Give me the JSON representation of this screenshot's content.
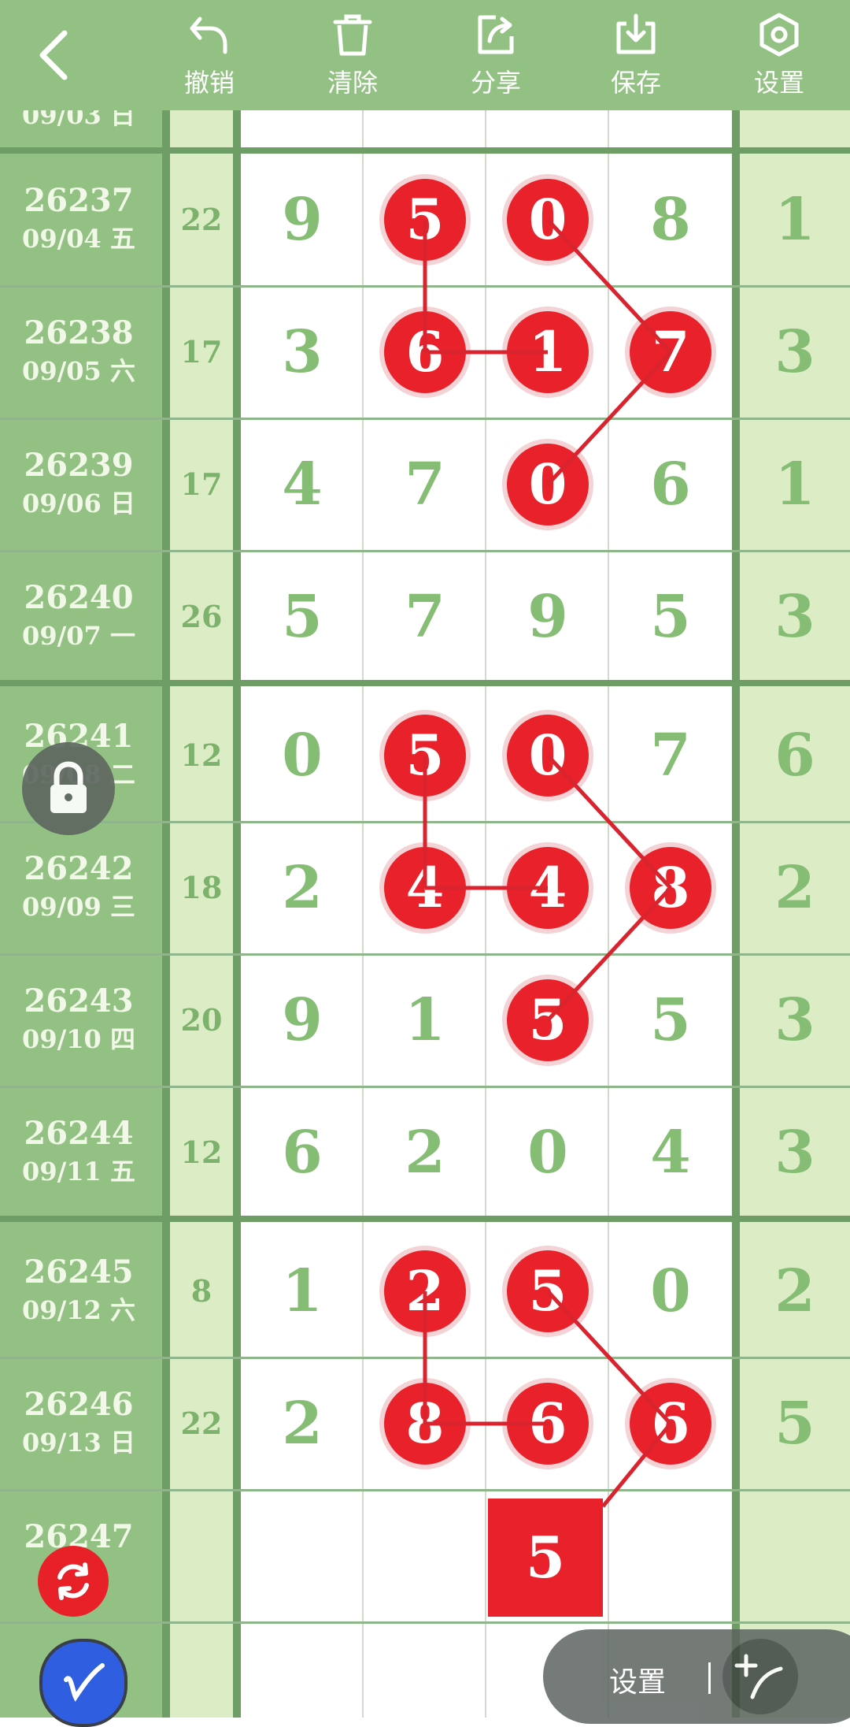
{
  "toolbar": {
    "back_icon": "chevron-left-icon",
    "buttons": [
      {
        "label": "撤销",
        "icon": "undo-icon"
      },
      {
        "label": "清除",
        "icon": "trash-icon"
      },
      {
        "label": "分享",
        "icon": "share-icon"
      },
      {
        "label": "保存",
        "icon": "download-icon"
      },
      {
        "label": "设置",
        "icon": "settings-hexagon-icon"
      }
    ]
  },
  "colors": {
    "toolbar_bg": "#93c184",
    "accent_red": "#e8212b",
    "digit_green": "#86bd75"
  },
  "rows": [
    {
      "issue": "26237",
      "date": "09/04 五",
      "sum": "22",
      "digits": [
        "9",
        "5",
        "0",
        "8"
      ],
      "hits": [
        1,
        2
      ],
      "last": "1"
    },
    {
      "issue": "26238",
      "date": "09/05 六",
      "sum": "17",
      "digits": [
        "3",
        "6",
        "1",
        "7"
      ],
      "hits": [
        1,
        2,
        3
      ],
      "last": "3"
    },
    {
      "issue": "26239",
      "date": "09/06 日",
      "sum": "17",
      "digits": [
        "4",
        "7",
        "0",
        "6"
      ],
      "hits": [
        2
      ],
      "last": "1"
    },
    {
      "issue": "26240",
      "date": "09/07 一",
      "sum": "26",
      "digits": [
        "5",
        "7",
        "9",
        "5"
      ],
      "hits": [],
      "last": "3"
    },
    {
      "issue": "26241",
      "date": "09/08 二",
      "sum": "12",
      "digits": [
        "0",
        "5",
        "0",
        "7"
      ],
      "hits": [
        1,
        2
      ],
      "last": "6"
    },
    {
      "issue": "26242",
      "date": "09/09 三",
      "sum": "18",
      "digits": [
        "2",
        "4",
        "4",
        "8"
      ],
      "hits": [
        1,
        2,
        3
      ],
      "last": "2"
    },
    {
      "issue": "26243",
      "date": "09/10 四",
      "sum": "20",
      "digits": [
        "9",
        "1",
        "5",
        "5"
      ],
      "hits": [
        2
      ],
      "last": "3"
    },
    {
      "issue": "26244",
      "date": "09/11 五",
      "sum": "12",
      "digits": [
        "6",
        "2",
        "0",
        "4"
      ],
      "hits": [],
      "last": "3"
    },
    {
      "issue": "26245",
      "date": "09/12 六",
      "sum": "8",
      "digits": [
        "1",
        "2",
        "5",
        "0"
      ],
      "hits": [
        1,
        2
      ],
      "last": "2"
    },
    {
      "issue": "26246",
      "date": "09/13 日",
      "sum": "22",
      "digits": [
        "2",
        "8",
        "6",
        "6"
      ],
      "hits": [
        1,
        2,
        3
      ],
      "last": "5"
    },
    {
      "issue": "26247",
      "date": "",
      "sum": "",
      "digits": [
        "",
        "",
        "",
        ""
      ],
      "hits": [],
      "last": ""
    }
  ],
  "prediction": {
    "value": "5"
  },
  "top_partial_date": "09/03 日",
  "floating": {
    "lock_icon": "lock-icon",
    "refresh_icon": "refresh-icon",
    "pen_icon": "pen-icon",
    "pill_label": "设置",
    "pill_icon": "add-line-icon"
  }
}
